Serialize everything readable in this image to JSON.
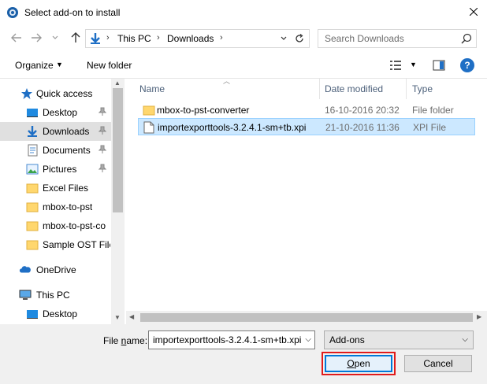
{
  "window": {
    "title": "Select add-on to install"
  },
  "addressbar": {
    "crumbs": [
      "This PC",
      "Downloads"
    ]
  },
  "search": {
    "placeholder": "Search Downloads"
  },
  "toolbar": {
    "organize": "Organize",
    "new_folder": "New folder",
    "help": "?"
  },
  "sidebar": {
    "items": [
      {
        "label": "Quick access",
        "icon": "star-icon"
      },
      {
        "label": "Desktop",
        "icon": "desktop-icon",
        "pinned": true
      },
      {
        "label": "Downloads",
        "icon": "download-icon",
        "pinned": true,
        "selected": true
      },
      {
        "label": "Documents",
        "icon": "documents-icon",
        "pinned": true
      },
      {
        "label": "Pictures",
        "icon": "pictures-icon",
        "pinned": true
      },
      {
        "label": "Excel Files",
        "icon": "folder-icon"
      },
      {
        "label": "mbox-to-pst",
        "icon": "folder-icon"
      },
      {
        "label": "mbox-to-pst-co",
        "icon": "folder-icon"
      },
      {
        "label": "Sample OST File",
        "icon": "folder-icon"
      },
      {
        "label": "OneDrive",
        "icon": "cloud-icon"
      },
      {
        "label": "This PC",
        "icon": "computer-icon"
      },
      {
        "label": "Desktop",
        "icon": "desktop-icon"
      }
    ]
  },
  "filelist": {
    "columns": [
      "Name",
      "Date modified",
      "Type"
    ],
    "rows": [
      {
        "name": "mbox-to-pst-converter",
        "date": "16-10-2016 20:32",
        "type": "File folder",
        "icon": "folder-icon"
      },
      {
        "name": "importexporttools-3.2.4.1-sm+tb.xpi",
        "date": "21-10-2016 11:36",
        "type": "XPI File",
        "icon": "file-icon",
        "selected": true
      }
    ]
  },
  "footer": {
    "file_name_label": "File name:",
    "file_name_value": "importexporttools-3.2.4.1-sm+tb.xpi",
    "filter_value": "Add-ons",
    "open_label": "Open",
    "cancel_label": "Cancel"
  },
  "colors": {
    "accent": "#0078d7",
    "highlight": "#e01b1b",
    "selection": "#cce8ff"
  }
}
